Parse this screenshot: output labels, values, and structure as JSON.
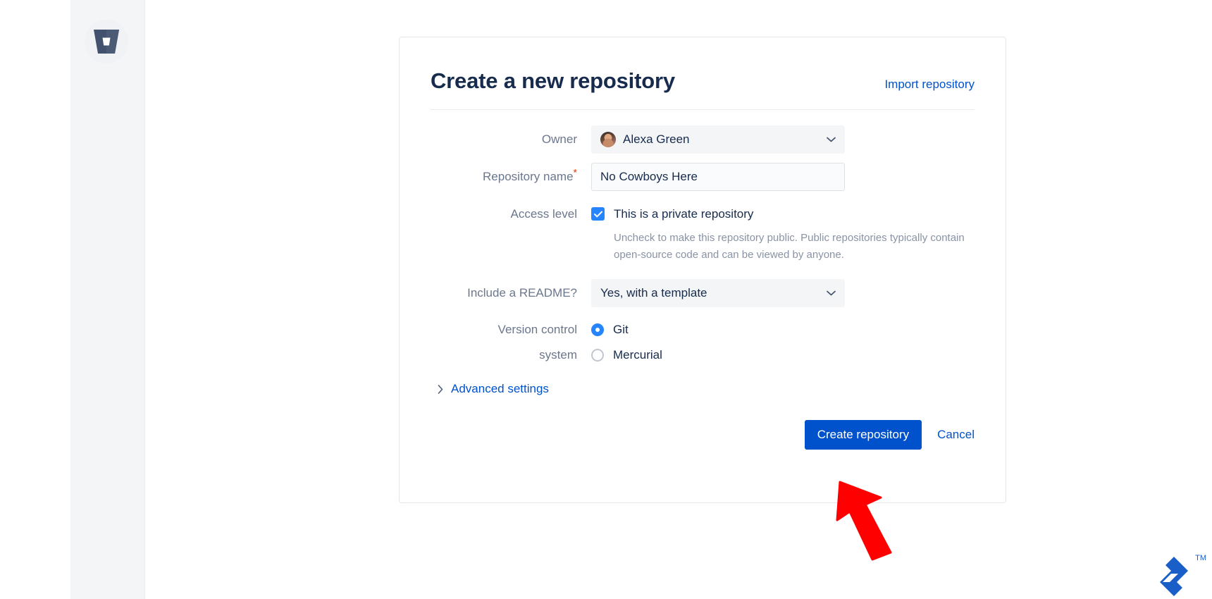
{
  "sidebar": {
    "logo_icon": "bitbucket-logo-icon",
    "logo_color": "#42526e"
  },
  "card": {
    "title": "Create a new repository",
    "import_link": "Import repository"
  },
  "form": {
    "owner": {
      "label": "Owner",
      "value": "Alexa Green",
      "avatar_icon": "user-avatar",
      "chevron_icon": "chevron-down-icon"
    },
    "repository_name": {
      "label": "Repository name",
      "required_marker": "*",
      "value": "No Cowboys Here",
      "placeholder": ""
    },
    "access_level": {
      "label": "Access level",
      "checkbox_label": "This is a private repository",
      "checked": true,
      "check_icon": "checkmark-icon",
      "help_text": "Uncheck to make this repository public. Public repositories typically contain open-source code and can be viewed by anyone."
    },
    "readme": {
      "label": "Include a README?",
      "value": "Yes, with a template",
      "chevron_icon": "chevron-down-icon"
    },
    "version_control": {
      "label_line1": "Version control",
      "label_line2": "system",
      "options": [
        {
          "label": "Git",
          "selected": true
        },
        {
          "label": "Mercurial",
          "selected": false
        }
      ]
    },
    "advanced_settings": {
      "label": "Advanced settings",
      "chevron_icon": "chevron-right-icon",
      "expanded": false
    }
  },
  "actions": {
    "create_label": "Create repository",
    "cancel_label": "Cancel",
    "primary_color": "#0052cc"
  },
  "annotations": {
    "arrow_icon": "red-arrow-pointer",
    "arrow_color": "#ff0000"
  },
  "watermark": {
    "mark_icon": "atlassian-mark-icon",
    "trademark": "TM",
    "color": "#1a5fc8"
  }
}
